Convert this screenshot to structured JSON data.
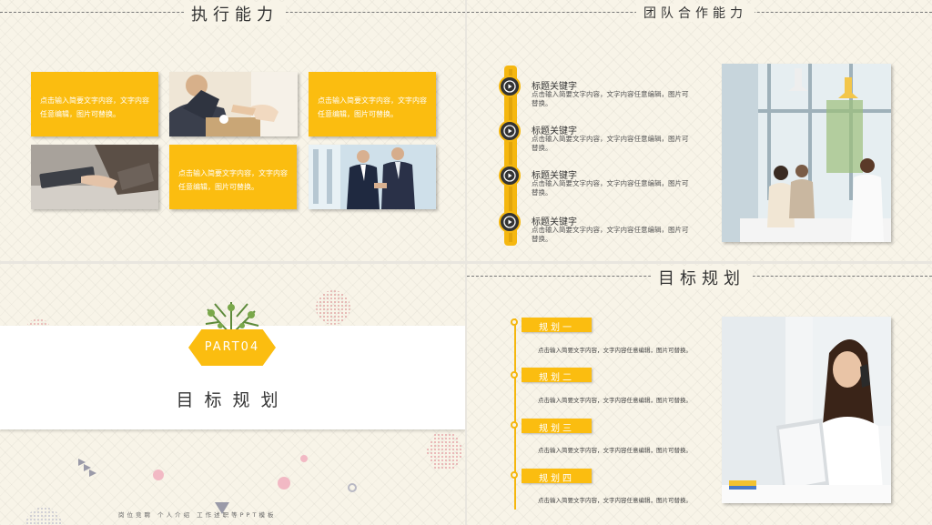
{
  "slide1": {
    "title": "执行能力",
    "boxes": [
      "点击输入简要文字内容，文字内容任意编辑，图片可替换。",
      "点击输入简要文字内容，文字内容任意编辑，图片可替换。",
      "点击输入简要文字内容，文字内容任意编辑，图片可替换。"
    ]
  },
  "slide2": {
    "title": "团队合作能力",
    "items": [
      {
        "title": "标题关键字",
        "desc": "点击输入简要文字内容，文字内容任意编辑，图片可替换。"
      },
      {
        "title": "标题关键字",
        "desc": "点击输入简要文字内容，文字内容任意编辑，图片可替换。"
      },
      {
        "title": "标题关键字",
        "desc": "点击输入简要文字内容，文字内容任意编辑，图片可替换。"
      },
      {
        "title": "标题关键字",
        "desc": "点击输入简要文字内容，文字内容任意编辑，图片可替换。"
      }
    ]
  },
  "slide3": {
    "part": "PART04",
    "title": "目标规划",
    "footer": "岗位竞聘 个人介绍 工作述职等PPT模板"
  },
  "slide4": {
    "title": "目标规划",
    "steps": [
      {
        "label": "规划一",
        "desc": "点击输入简要文字内容，文字内容任意编辑，图片可替换。"
      },
      {
        "label": "规划二",
        "desc": "点击输入简要文字内容，文字内容任意编辑，图片可替换。"
      },
      {
        "label": "规划三",
        "desc": "点击输入简要文字内容，文字内容任意编辑，图片可替换。"
      },
      {
        "label": "规划四",
        "desc": "点击输入简要文字内容，文字内容任意编辑，图片可替换。"
      }
    ]
  },
  "colors": {
    "accent": "#fbbd10",
    "background": "#f8f4e8",
    "text": "#333333"
  }
}
